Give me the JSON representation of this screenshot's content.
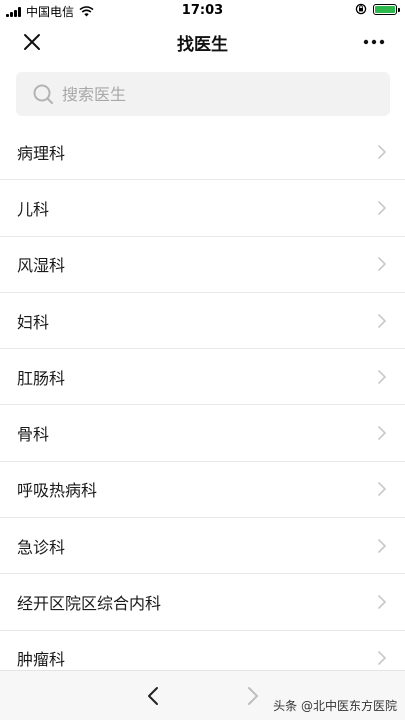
{
  "status_bar": {
    "carrier": "中国电信",
    "time": "17:03",
    "battery_color": "#2db84d"
  },
  "nav": {
    "title": "找医生",
    "close_icon": "close-icon",
    "more_icon": "more-icon"
  },
  "search": {
    "placeholder": "搜索医生",
    "value": ""
  },
  "departments": [
    {
      "label": "病理科"
    },
    {
      "label": "儿科"
    },
    {
      "label": "风湿科"
    },
    {
      "label": "妇科"
    },
    {
      "label": "肛肠科"
    },
    {
      "label": "骨科"
    },
    {
      "label": "呼吸热病科"
    },
    {
      "label": "急诊科"
    },
    {
      "label": "经开区院区综合内科"
    },
    {
      "label": "肿瘤科"
    }
  ],
  "watermark": "头条 @北中医东方医院"
}
